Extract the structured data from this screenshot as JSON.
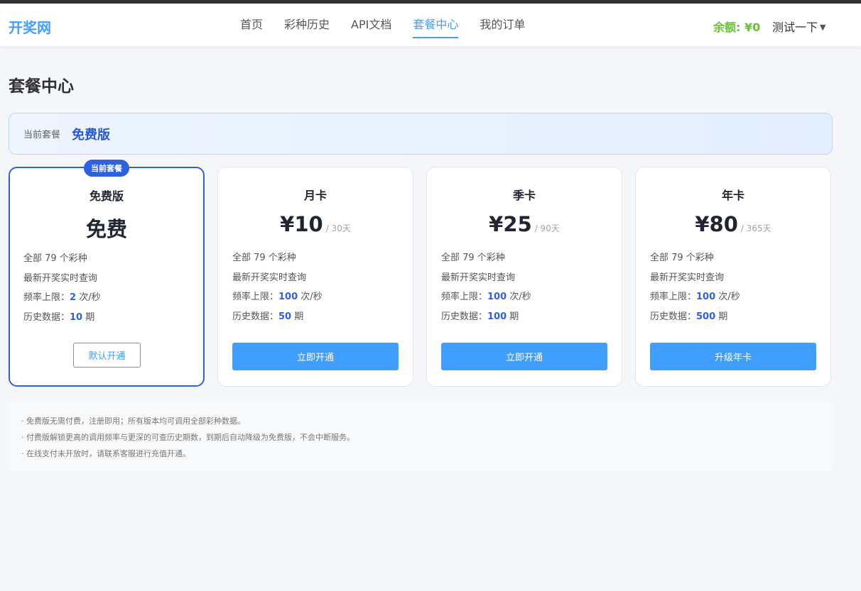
{
  "header": {
    "logo": "开奖网",
    "nav": [
      {
        "label": "首页"
      },
      {
        "label": "彩种历史"
      },
      {
        "label": "API文档"
      },
      {
        "label": "套餐中心"
      },
      {
        "label": "我的订单"
      }
    ],
    "balance": "余额: ¥0",
    "user": "测试一下",
    "user_caret": "▼"
  },
  "page": {
    "title": "套餐中心",
    "current_plan_label": "当前套餐",
    "current_plan_value": "免费版"
  },
  "plans": [
    {
      "badge": "当前套餐",
      "name": "免费版",
      "price": "免费",
      "period": "",
      "features": {
        "all": "全部 79 个彩种",
        "realtime": "最新开奖实时查询",
        "rate_label": "频率上限：",
        "rate_value": "2",
        "rate_unit": " 次/秒",
        "history_label": "历史数据：",
        "history_value": "10",
        "history_unit": " 期"
      },
      "button": "默认开通"
    },
    {
      "name": "月卡",
      "price": "¥10",
      "period": "/ 30天",
      "features": {
        "all": "全部 79 个彩种",
        "realtime": "最新开奖实时查询",
        "rate_label": "频率上限：",
        "rate_value": "100",
        "rate_unit": " 次/秒",
        "history_label": "历史数据：",
        "history_value": "50",
        "history_unit": " 期"
      },
      "button": "立即开通"
    },
    {
      "name": "季卡",
      "price": "¥25",
      "period": "/ 90天",
      "features": {
        "all": "全部 79 个彩种",
        "realtime": "最新开奖实时查询",
        "rate_label": "频率上限：",
        "rate_value": "100",
        "rate_unit": " 次/秒",
        "history_label": "历史数据：",
        "history_value": "100",
        "history_unit": " 期"
      },
      "button": "立即开通"
    },
    {
      "name": "年卡",
      "price": "¥80",
      "period": "/ 365天",
      "features": {
        "all": "全部 79 个彩种",
        "realtime": "最新开奖实时查询",
        "rate_label": "频率上限：",
        "rate_value": "100",
        "rate_unit": " 次/秒",
        "history_label": "历史数据：",
        "history_value": "500",
        "history_unit": " 期"
      },
      "button": "升级年卡"
    }
  ],
  "notes": [
    "· 免费版无需付费，注册即用；所有版本均可调用全部彩种数据。",
    "· 付费版解锁更高的调用频率与更深的可查历史期数，到期后自动降级为免费版，不会中断服务。",
    "· 在线支付未开放时，请联系客服进行充值开通。"
  ],
  "colors": {
    "accent": "#409eff",
    "primary": "#2c62e0",
    "balance": "#67c23a"
  }
}
